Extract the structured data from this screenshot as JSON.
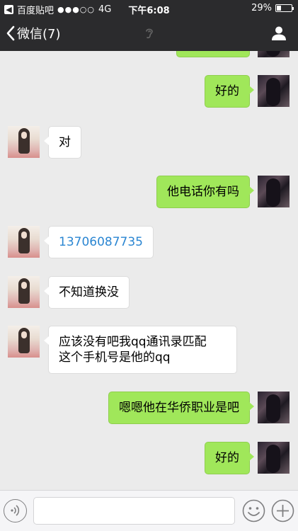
{
  "status_bar": {
    "back_app": "百度贴吧",
    "signal": "●●●○○",
    "network": "4G",
    "time": "下午6:08",
    "battery": "29%",
    "battery_level": 0.29
  },
  "nav": {
    "back_label": "微信(7)"
  },
  "messages": [
    {
      "side": "right",
      "text": "好的"
    },
    {
      "side": "left",
      "text": "对"
    },
    {
      "side": "right",
      "text": "他电话你有吗"
    },
    {
      "side": "left",
      "text": "13706087735"
    },
    {
      "side": "left",
      "text": "不知道换没"
    },
    {
      "side": "left",
      "line1": "应该没有吧我qq通讯录匹配",
      "line2": "这个手机号是他的qq"
    },
    {
      "side": "right",
      "text": "嗯嗯他在华侨职业是吧"
    },
    {
      "side": "right",
      "text": "好的"
    }
  ],
  "colors": {
    "nav_bg": "#2b2b2d",
    "chat_bg": "#ebebeb",
    "bubble_sent": "#a0e75a",
    "bubble_received": "#ffffff",
    "link": "#2b86d2"
  },
  "icons": {
    "back": "chevron-left-icon",
    "earpiece": "ear-icon",
    "profile": "person-icon",
    "voice": "voice-icon",
    "emoji": "emoji-icon",
    "more": "plus-icon"
  }
}
